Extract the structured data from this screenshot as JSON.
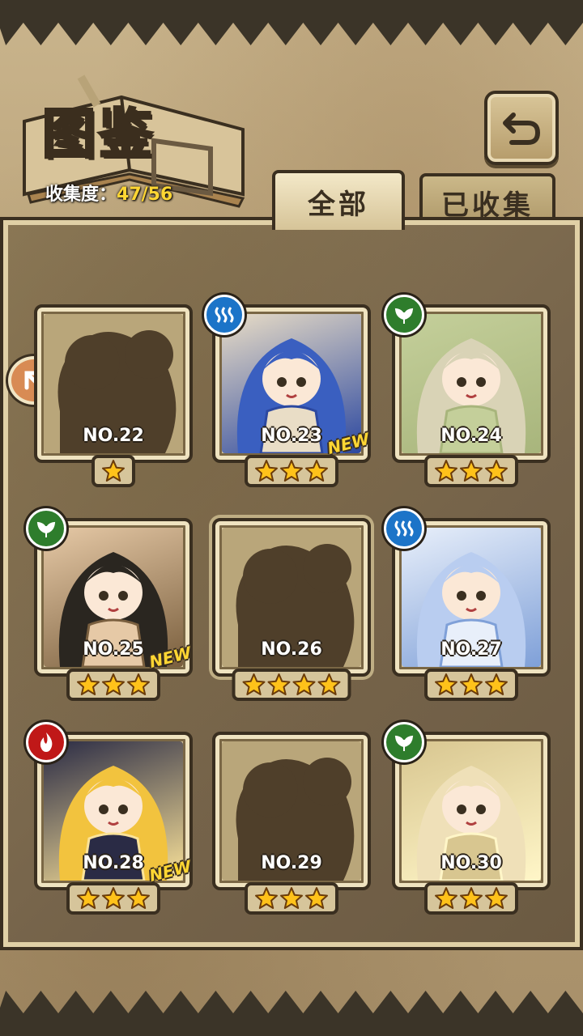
{
  "header": {
    "title": "图鉴",
    "collection_label": "收集度：",
    "collection_value": "47/56"
  },
  "tabs": [
    {
      "label": "全部",
      "active": true
    },
    {
      "label": "已收集",
      "active": false
    }
  ],
  "cards": [
    {
      "number": "NO.22",
      "stars": 1,
      "attribute": null,
      "is_new": false,
      "collected": false
    },
    {
      "number": "NO.23",
      "stars": 3,
      "attribute": "water",
      "is_new": true,
      "collected": true
    },
    {
      "number": "NO.24",
      "stars": 3,
      "attribute": "wood",
      "is_new": false,
      "collected": true
    },
    {
      "number": "NO.25",
      "stars": 3,
      "attribute": "wood",
      "is_new": true,
      "collected": true
    },
    {
      "number": "NO.26",
      "stars": 4,
      "attribute": null,
      "is_new": false,
      "collected": false
    },
    {
      "number": "NO.27",
      "stars": 3,
      "attribute": "water",
      "is_new": false,
      "collected": true
    },
    {
      "number": "NO.28",
      "stars": 3,
      "attribute": "fire",
      "is_new": true,
      "collected": true
    },
    {
      "number": "NO.29",
      "stars": 3,
      "attribute": null,
      "is_new": false,
      "collected": false
    },
    {
      "number": "NO.30",
      "stars": 3,
      "attribute": "wood",
      "is_new": false,
      "collected": true
    }
  ],
  "new_badge": "NEW",
  "colors": {
    "water": "#1c74c8",
    "wood": "#2e7d2c",
    "fire": "#c01818",
    "star": "#ffc21a",
    "accent_text": "#ffd633"
  },
  "icons": {
    "back": "back-arrow-icon",
    "side": "scroll-prev-icon"
  }
}
